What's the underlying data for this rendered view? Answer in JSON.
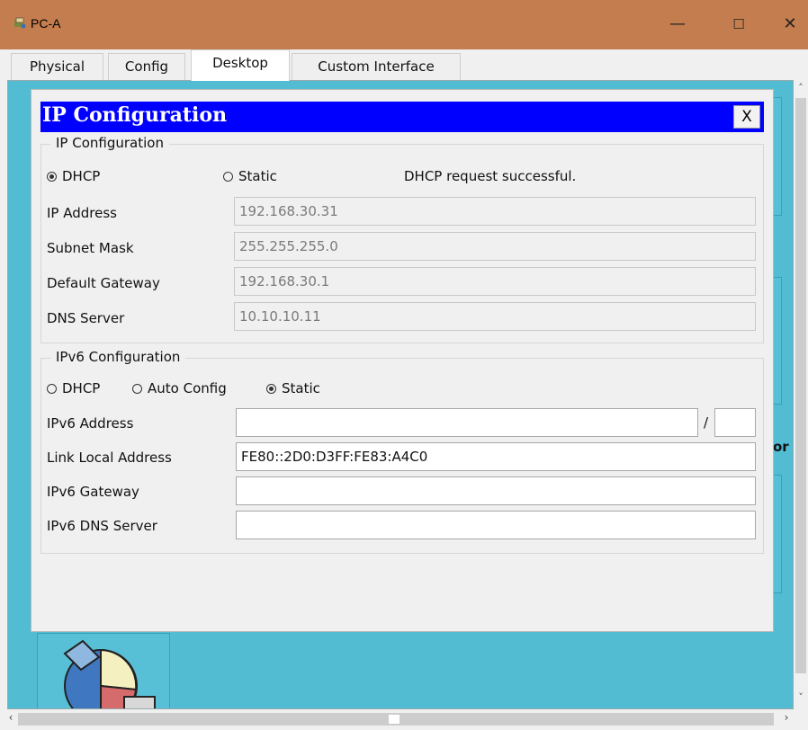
{
  "window": {
    "title": "PC-A",
    "min": "—",
    "max": "☐",
    "close": "✕"
  },
  "tabs": [
    "Physical",
    "Config",
    "Desktop",
    "Custom Interface"
  ],
  "background": {
    "partial_text_1": "or"
  },
  "dialog": {
    "title": "IP Configuration",
    "close_label": "X",
    "ipv4": {
      "legend": "IP Configuration",
      "dhcp_label": "DHCP",
      "static_label": "Static",
      "mode": "DHCP",
      "status": "DHCP request successful.",
      "ip_label": "IP Address",
      "ip_value": "192.168.30.31",
      "mask_label": "Subnet Mask",
      "mask_value": "255.255.255.0",
      "gw_label": "Default Gateway",
      "gw_value": "192.168.30.1",
      "dns_label": "DNS Server",
      "dns_value": "10.10.10.11"
    },
    "ipv6": {
      "legend": "IPv6 Configuration",
      "dhcp_label": "DHCP",
      "auto_label": "Auto Config",
      "static_label": "Static",
      "mode": "Static",
      "addr_label": "IPv6 Address",
      "addr_value": "",
      "prefix_sep": "/",
      "prefix_value": "",
      "link_label": "Link Local Address",
      "link_value": "FE80::2D0:D3FF:FE83:A4C0",
      "gw_label": "IPv6 Gateway",
      "gw_value": "",
      "dns_label": "IPv6 DNS Server",
      "dns_value": ""
    }
  }
}
